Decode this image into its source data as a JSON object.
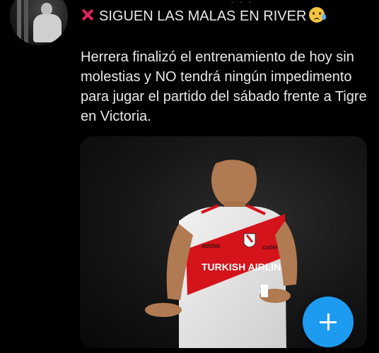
{
  "tweet": {
    "headline": "SIGUEN LAS MALAS EN RIVER",
    "body": "Herrera finalizó el entrenamiento de hoy sin molestias y NO tendrá ningún impedimento para jugar el partido del sábado frente a Tigre en Victoria."
  },
  "media": {
    "jersey_text": "TURKISH AIRLINES",
    "sponsor_left": "adidas",
    "sponsor_right": "codere"
  },
  "icons": {
    "headline_prefix": "cross-mark-icon",
    "headline_suffix": "sad-tear-emoji-icon",
    "fab": "plus-icon"
  },
  "colors": {
    "accent": "#1d9bf0",
    "cross": "#e0245e",
    "background": "#000000",
    "text": "#e7e9ea"
  }
}
